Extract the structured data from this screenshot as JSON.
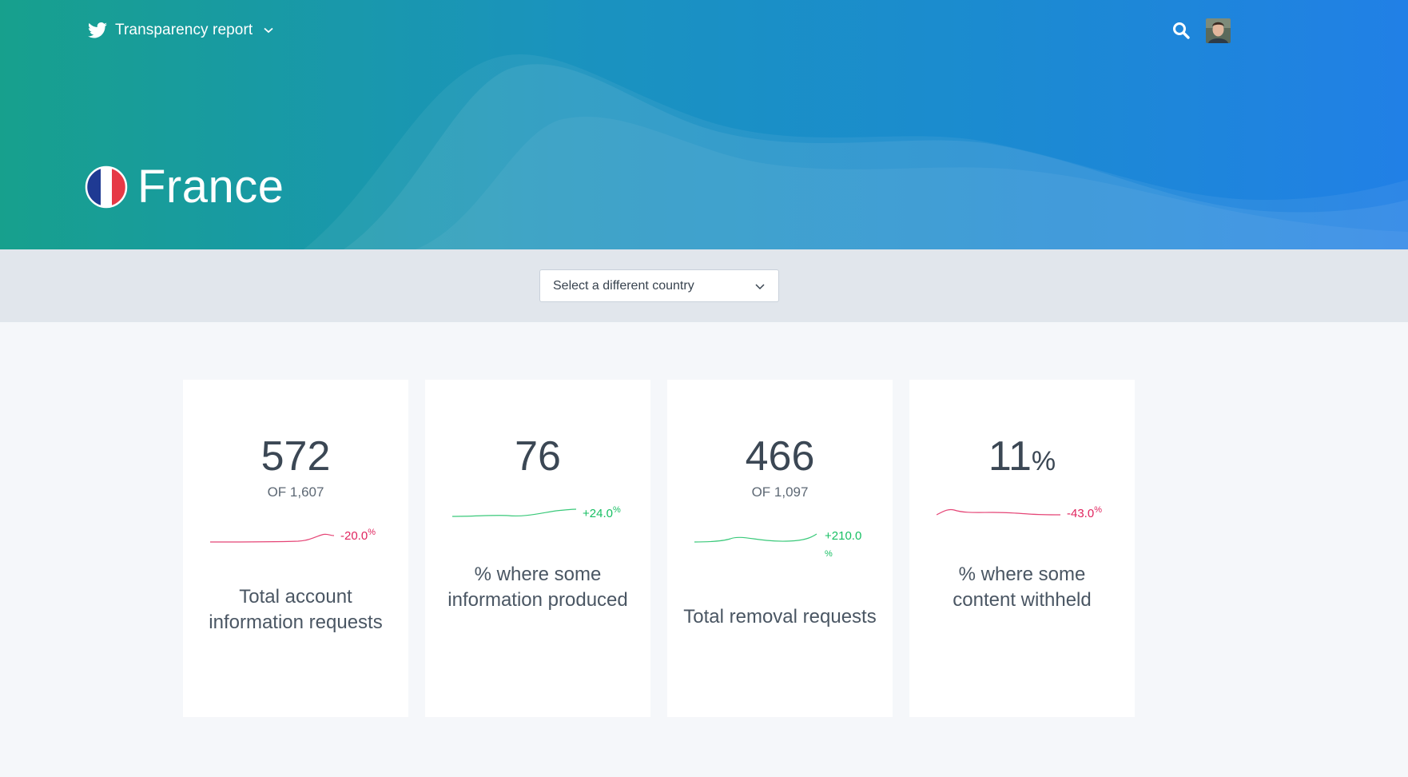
{
  "header": {
    "brand_label": "Transparency report",
    "country_name": "France"
  },
  "selector": {
    "label": "Select a different country"
  },
  "colors": {
    "negative": "#e0245e",
    "positive": "#17bf63",
    "hero_start": "#17a08d",
    "hero_end": "#2180e6"
  },
  "cards": [
    {
      "value": "572",
      "of": "OF 1,607",
      "delta": "-20.0",
      "delta_unit": "%",
      "trend": "negative",
      "label": "Total account information requests"
    },
    {
      "value": "76",
      "of": "",
      "delta": "+24.0",
      "delta_unit": "%",
      "trend": "positive",
      "label": "% where some information produced"
    },
    {
      "value": "466",
      "of": "OF 1,097",
      "delta": "+210.0",
      "delta_unit": "%",
      "trend": "positive",
      "label": "Total removal requests"
    },
    {
      "value": "11",
      "value_unit": "%",
      "of": "",
      "delta": "-43.0",
      "delta_unit": "%",
      "trend": "negative",
      "label": "% where some content withheld"
    }
  ],
  "icons": [
    "twitter-bird-icon",
    "chevron-down-icon",
    "search-icon",
    "avatar",
    "france-flag-icon"
  ]
}
